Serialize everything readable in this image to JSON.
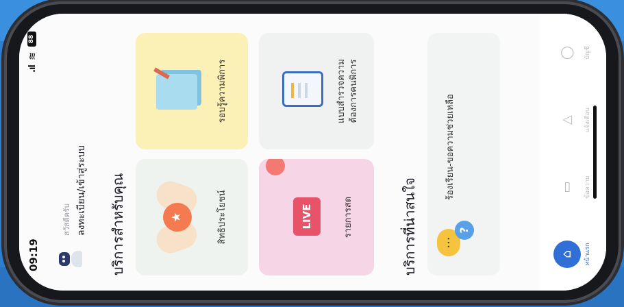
{
  "status": {
    "time": "09:19",
    "battery": "88"
  },
  "profile": {
    "greeting": "สวัสดีครับ",
    "login_link": "ลงทะเบียน/เข้าสู่ระบบ"
  },
  "section_services": {
    "title": "บริการสำหรับคุณ"
  },
  "cards": {
    "benefit": "สิทธิประโยชน์",
    "debt": "รอบรู้ความพิการ",
    "live": "รายการสด",
    "live_badge": "LIVE",
    "survey_line1": "แบบสำรวจความ",
    "survey_line2": "ต้องการคนพิการ"
  },
  "section_interest": {
    "title": "บริการที่น่าสนใจ"
  },
  "chat_card": {
    "label": "ร้องเรียน-ขอความช่วยเหลือ",
    "bubble_text": "...",
    "bubble_q": "?"
  },
  "tabbar": {
    "items": [
      {
        "label": "หน้าแรก",
        "icon": "home-icon"
      },
      {
        "label": "ข้อความ",
        "icon": "message-icon"
      },
      {
        "label": "แจ้งเตือน",
        "icon": "bell-icon"
      },
      {
        "label": "บัญชี",
        "icon": "profile-icon"
      }
    ]
  },
  "colors": {
    "accent": "#2f6fd6",
    "live": "#e7546a",
    "yellow_card": "#fbf1b7",
    "pink_card": "#f6d5e6"
  }
}
